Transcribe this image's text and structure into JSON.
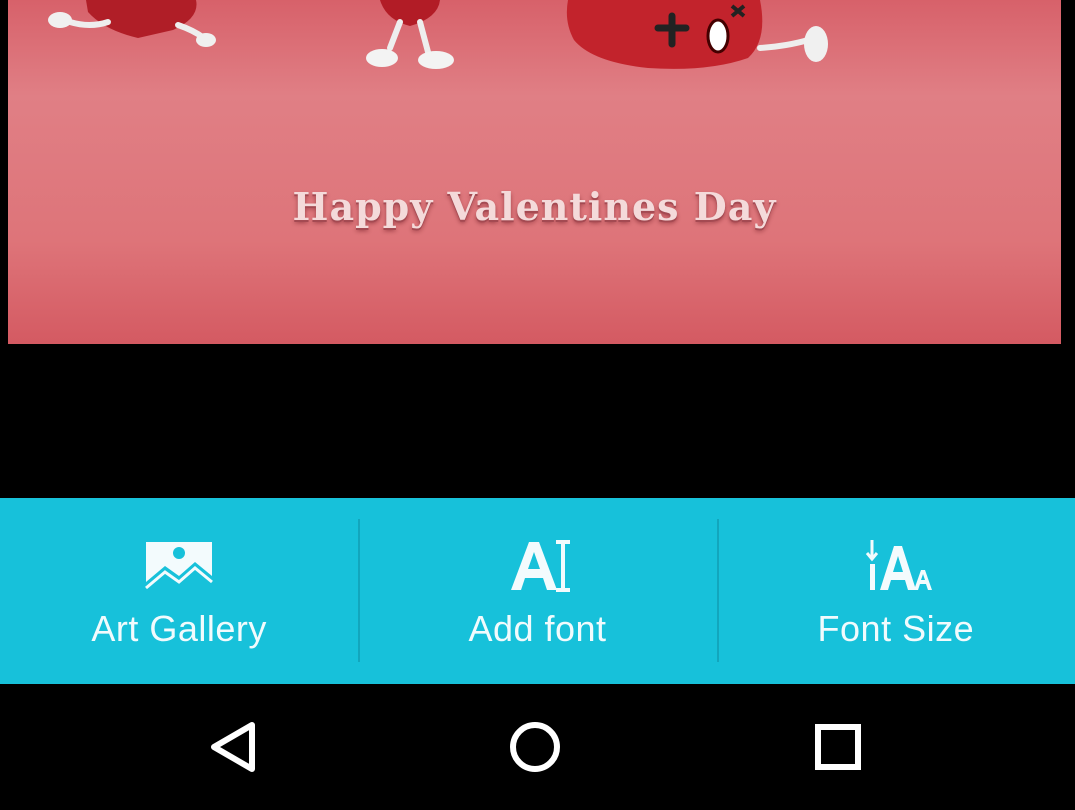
{
  "card": {
    "greeting": "Happy Valentines Day"
  },
  "toolbar": {
    "items": [
      {
        "label": "Art Gallery",
        "icon": "image-icon"
      },
      {
        "label": "Add font",
        "icon": "text-cursor-icon"
      },
      {
        "label": "Font Size",
        "icon": "font-size-icon"
      }
    ]
  },
  "navbar": {
    "back": "back-icon",
    "home": "home-icon",
    "recents": "recents-icon"
  },
  "colors": {
    "toolbar_bg": "#17c1da",
    "card_bg": "#de7479",
    "nav_bg": "#000000"
  }
}
